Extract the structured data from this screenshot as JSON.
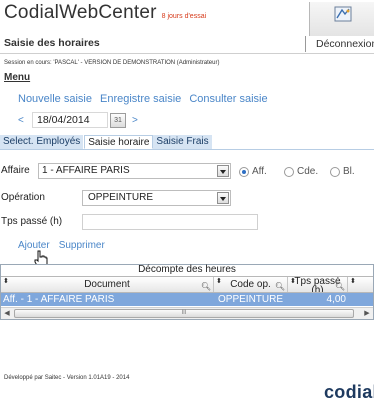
{
  "app": {
    "title": "CodialWebCenter",
    "trial_notice": "8 jours d'essai"
  },
  "header": {
    "page_title": "Saisie des horaires",
    "logout": "Déconnexion",
    "session_info": "Session en cours: 'PASCAL' - VERSION DE DEMONSTRATION (Administrateur)",
    "menu": "Menu"
  },
  "actions": {
    "new": "Nouvelle saisie",
    "save": "Enregistre saisie",
    "view": "Consulter saisie"
  },
  "date_nav": {
    "prev": "<",
    "date": "18/04/2014",
    "calendar_day": "31",
    "next": ">"
  },
  "tabs": [
    {
      "label": "Select. Employés"
    },
    {
      "label": "Saisie horaire"
    },
    {
      "label": "Saisie Frais"
    }
  ],
  "form": {
    "affaire_label": "Affaire",
    "affaire_value": "1 - AFFAIRE PARIS",
    "radios": [
      {
        "label": "Aff.",
        "selected": true
      },
      {
        "label": "Cde.",
        "selected": false
      },
      {
        "label": "Bl.",
        "selected": false
      }
    ],
    "operation_label": "Opération",
    "operation_value": "OPPEINTURE",
    "tps_label": "Tps passé (h)",
    "tps_value": ""
  },
  "grid_actions": {
    "add": "Ajouter",
    "delete": "Supprimer"
  },
  "grid": {
    "title": "Décompte des heures",
    "columns": [
      "Document",
      "Code op.",
      "Tps passé (h)"
    ],
    "rows": [
      {
        "document": "Aff. - 1 - AFFAIRE PARIS",
        "code": "OPPEINTURE",
        "time": "4,00"
      }
    ],
    "scroll_grip": "III"
  },
  "footer": {
    "text": "Développé par Saitec - Version 1.01A19 - 2014",
    "brand": "codial",
    "brand_tail": "®"
  },
  "colors": {
    "link": "#4a86c8",
    "selected_row": "#7fa7dc",
    "trial": "#d63a1a"
  }
}
